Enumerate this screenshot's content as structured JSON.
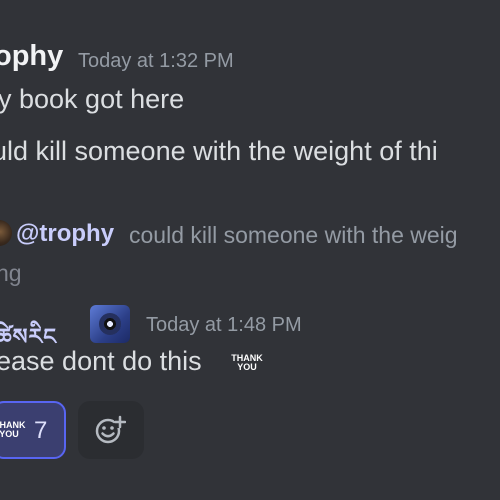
{
  "messages": [
    {
      "author": "ophy",
      "timestamp": "Today at 1:32 PM",
      "lines": [
        "y book got here",
        "uld kill someone with the weight of thi"
      ]
    },
    {
      "reply": {
        "mention": "@trophy",
        "snippet": "could kill someone with the weig"
      },
      "line_above": "ng",
      "author": "ཚེསརིང",
      "timestamp": "Today at 1:48 PM",
      "body": "ease dont do this",
      "inline_emoji": "thank-you-emoji",
      "inline_emoji_text": "THANK\nYOU",
      "reactions": [
        {
          "emoji": "thank-you-emoji",
          "emoji_text": "THANK\nYOU",
          "count": "7",
          "reacted": true
        }
      ],
      "add_reaction_icon": "add-reaction-icon"
    }
  ],
  "colors": {
    "background": "#313338",
    "mention": "#c9cdfb",
    "reaction_border": "#5865f2",
    "reaction_bg": "#3b3f70",
    "muted": "#949ba4"
  }
}
